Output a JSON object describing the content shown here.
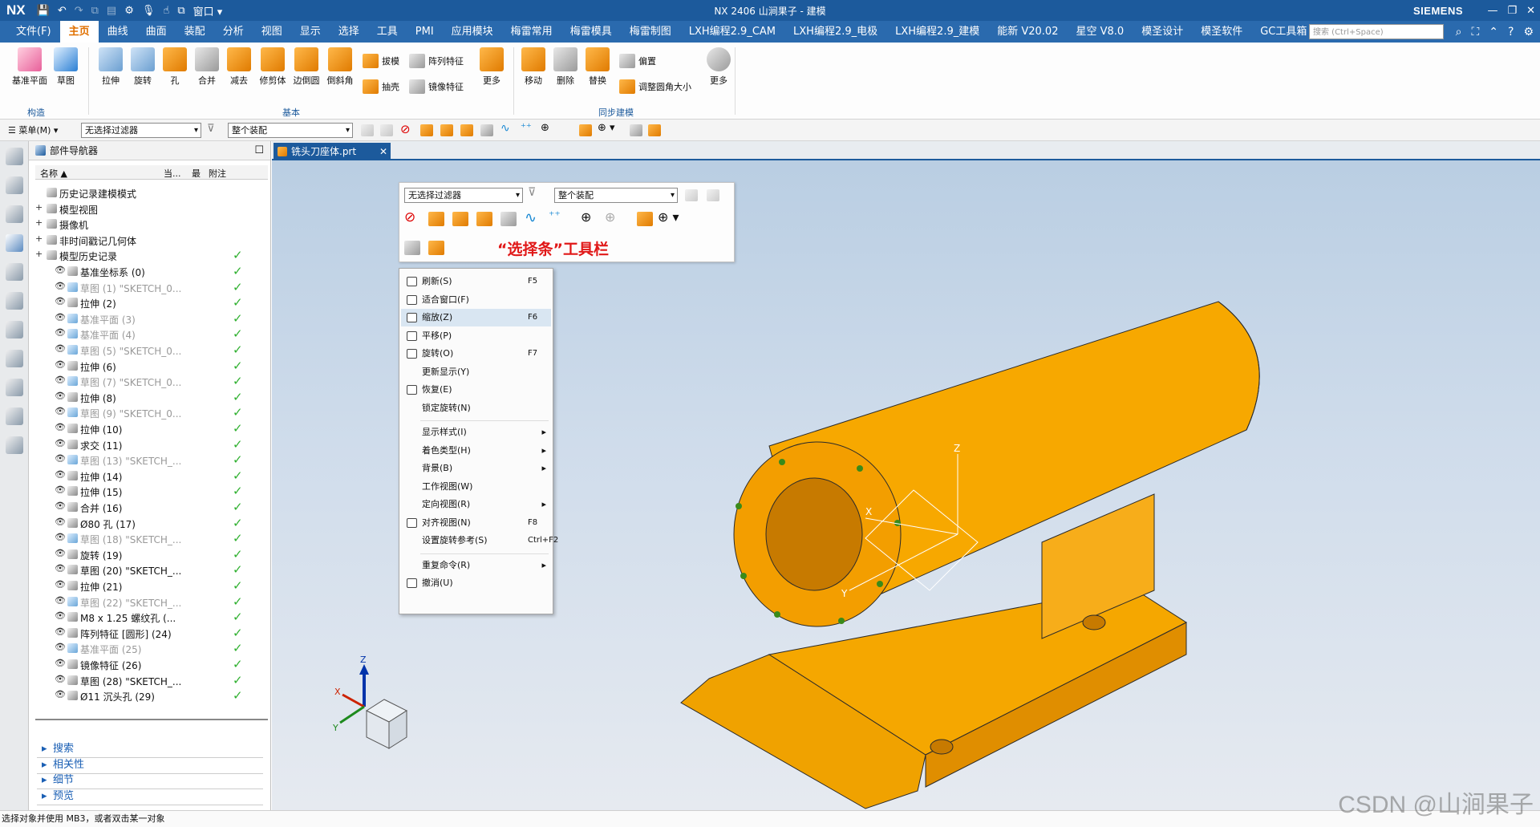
{
  "titlebar": {
    "logo": "NX",
    "title": "NX 2406 山涧果子 - 建模",
    "window_menu": "窗口",
    "brand": "SIEMENS"
  },
  "menubar": {
    "tabs": [
      "文件(F)",
      "主页",
      "曲线",
      "曲面",
      "装配",
      "分析",
      "视图",
      "显示",
      "选择",
      "工具",
      "PMI",
      "应用模块",
      "梅雷常用",
      "梅雷模具",
      "梅雷制图",
      "LXH编程2.9_CAM",
      "LXH编程2.9_电极",
      "LXH编程2.9_建模",
      "能新 V20.02",
      "星空 V8.0",
      "模圣设计",
      "模圣软件",
      "GC工具箱"
    ],
    "active_tab": "主页",
    "search_placeholder": "搜索 (Ctrl+Space)"
  },
  "ribbon": {
    "construct": {
      "items": [
        "基准平面",
        "草图"
      ],
      "group": "构造"
    },
    "basic": {
      "items": [
        "拉伸",
        "旋转",
        "孔",
        "合并",
        "减去",
        "修剪体",
        "边倒圆",
        "倒斜角"
      ],
      "small_items": [
        "拔模",
        "阵列特征",
        "抽壳",
        "镜像特征"
      ],
      "more": "更多",
      "group": "基本"
    },
    "sync": {
      "items": [
        "移动",
        "删除",
        "替换"
      ],
      "small_items": [
        "偏置",
        "调整圆角大小"
      ],
      "more": "更多",
      "group": "同步建模"
    }
  },
  "selbar": {
    "menu": "菜单(M)",
    "filter": "无选择过滤器",
    "scope": "整个装配"
  },
  "navigator": {
    "title": "部件导航器",
    "columns": {
      "name": "名称",
      "current": "当...",
      "latest": "最",
      "attach": "附注"
    },
    "rows": [
      {
        "label": "历史记录建模模式",
        "indent": 0,
        "dim": false,
        "check": false
      },
      {
        "label": "模型视图",
        "indent": 0,
        "dim": false,
        "check": false
      },
      {
        "label": "摄像机",
        "indent": 0,
        "dim": false,
        "check": false
      },
      {
        "label": "非时间戳记几何体",
        "indent": 0,
        "dim": false,
        "check": false
      },
      {
        "label": "模型历史记录",
        "indent": 0,
        "dim": false,
        "check": true
      },
      {
        "label": "基准坐标系 (0)",
        "indent": 1,
        "dim": false,
        "check": true
      },
      {
        "label": "草图 (1) \"SKETCH_0...",
        "indent": 1,
        "dim": true,
        "check": true
      },
      {
        "label": "拉伸 (2)",
        "indent": 1,
        "dim": false,
        "check": true
      },
      {
        "label": "基准平面 (3)",
        "indent": 1,
        "dim": true,
        "check": true
      },
      {
        "label": "基准平面 (4)",
        "indent": 1,
        "dim": true,
        "check": true
      },
      {
        "label": "草图 (5) \"SKETCH_0...",
        "indent": 1,
        "dim": true,
        "check": true
      },
      {
        "label": "拉伸 (6)",
        "indent": 1,
        "dim": false,
        "check": true
      },
      {
        "label": "草图 (7) \"SKETCH_0...",
        "indent": 1,
        "dim": true,
        "check": true
      },
      {
        "label": "拉伸 (8)",
        "indent": 1,
        "dim": false,
        "check": true
      },
      {
        "label": "草图 (9) \"SKETCH_0...",
        "indent": 1,
        "dim": true,
        "check": true
      },
      {
        "label": "拉伸 (10)",
        "indent": 1,
        "dim": false,
        "check": true
      },
      {
        "label": "求交 (11)",
        "indent": 1,
        "dim": false,
        "check": true
      },
      {
        "label": "草图 (13) \"SKETCH_...",
        "indent": 1,
        "dim": true,
        "check": true
      },
      {
        "label": "拉伸 (14)",
        "indent": 1,
        "dim": false,
        "check": true
      },
      {
        "label": "拉伸 (15)",
        "indent": 1,
        "dim": false,
        "check": true
      },
      {
        "label": "合并 (16)",
        "indent": 1,
        "dim": false,
        "check": true
      },
      {
        "label": "Ø80 孔 (17)",
        "indent": 1,
        "dim": false,
        "check": true
      },
      {
        "label": "草图 (18) \"SKETCH_...",
        "indent": 1,
        "dim": true,
        "check": true
      },
      {
        "label": "旋转 (19)",
        "indent": 1,
        "dim": false,
        "check": true
      },
      {
        "label": "草图 (20) \"SKETCH_...",
        "indent": 1,
        "dim": false,
        "check": true
      },
      {
        "label": "拉伸 (21)",
        "indent": 1,
        "dim": false,
        "check": true
      },
      {
        "label": "草图 (22) \"SKETCH_...",
        "indent": 1,
        "dim": true,
        "check": true
      },
      {
        "label": "M8 x 1.25 螺纹孔 (...",
        "indent": 1,
        "dim": false,
        "check": true
      },
      {
        "label": "阵列特征 [圆形] (24)",
        "indent": 1,
        "dim": false,
        "check": true
      },
      {
        "label": "基准平面 (25)",
        "indent": 1,
        "dim": true,
        "check": true
      },
      {
        "label": "镜像特征 (26)",
        "indent": 1,
        "dim": false,
        "check": true
      },
      {
        "label": "草图 (28) \"SKETCH_...",
        "indent": 1,
        "dim": false,
        "check": true
      },
      {
        "label": "Ø11 沉头孔 (29)",
        "indent": 1,
        "dim": false,
        "check": true
      }
    ],
    "panels": [
      "搜索",
      "相关性",
      "细节",
      "预览"
    ]
  },
  "viewport": {
    "doc_tab": "铣头刀座体.prt",
    "float_filter": "无选择过滤器",
    "float_scope": "整个装配",
    "annotation": "“选择条”工具栏",
    "context_menu": [
      {
        "label": "刷新(S)",
        "shortcut": "F5",
        "submenu": false
      },
      {
        "label": "适合窗口(F)",
        "shortcut": "",
        "submenu": false
      },
      {
        "label": "缩放(Z)",
        "shortcut": "F6",
        "submenu": false
      },
      {
        "label": "平移(P)",
        "shortcut": "",
        "submenu": false
      },
      {
        "label": "旋转(O)",
        "shortcut": "F7",
        "submenu": false
      },
      {
        "label": "更新显示(Y)",
        "shortcut": "",
        "submenu": false
      },
      {
        "label": "恢复(E)",
        "shortcut": "",
        "submenu": false
      },
      {
        "label": "锁定旋转(N)",
        "shortcut": "",
        "submenu": false
      },
      {
        "label": "显示样式(I)",
        "shortcut": "",
        "submenu": true
      },
      {
        "label": "着色类型(H)",
        "shortcut": "",
        "submenu": true
      },
      {
        "label": "背景(B)",
        "shortcut": "",
        "submenu": true
      },
      {
        "label": "工作视图(W)",
        "shortcut": "",
        "submenu": false
      },
      {
        "label": "定向视图(R)",
        "shortcut": "",
        "submenu": true
      },
      {
        "label": "对齐视图(N)",
        "shortcut": "F8",
        "submenu": false
      },
      {
        "label": "设置旋转参考(S)",
        "shortcut": "Ctrl+F2",
        "submenu": false
      },
      {
        "label": "重复命令(R)",
        "shortcut": "",
        "submenu": true
      },
      {
        "label": "撤消(U)",
        "shortcut": "",
        "submenu": false
      }
    ],
    "axis_labels": {
      "x": "X",
      "y": "Y",
      "z": "Z"
    }
  },
  "status": "选择对象并使用 MB3，或者双击某一对象",
  "watermark": "CSDN @山涧果子",
  "colors": {
    "accent": "#1c5a9c",
    "model": "#f5a000",
    "check": "#2fb02f"
  }
}
